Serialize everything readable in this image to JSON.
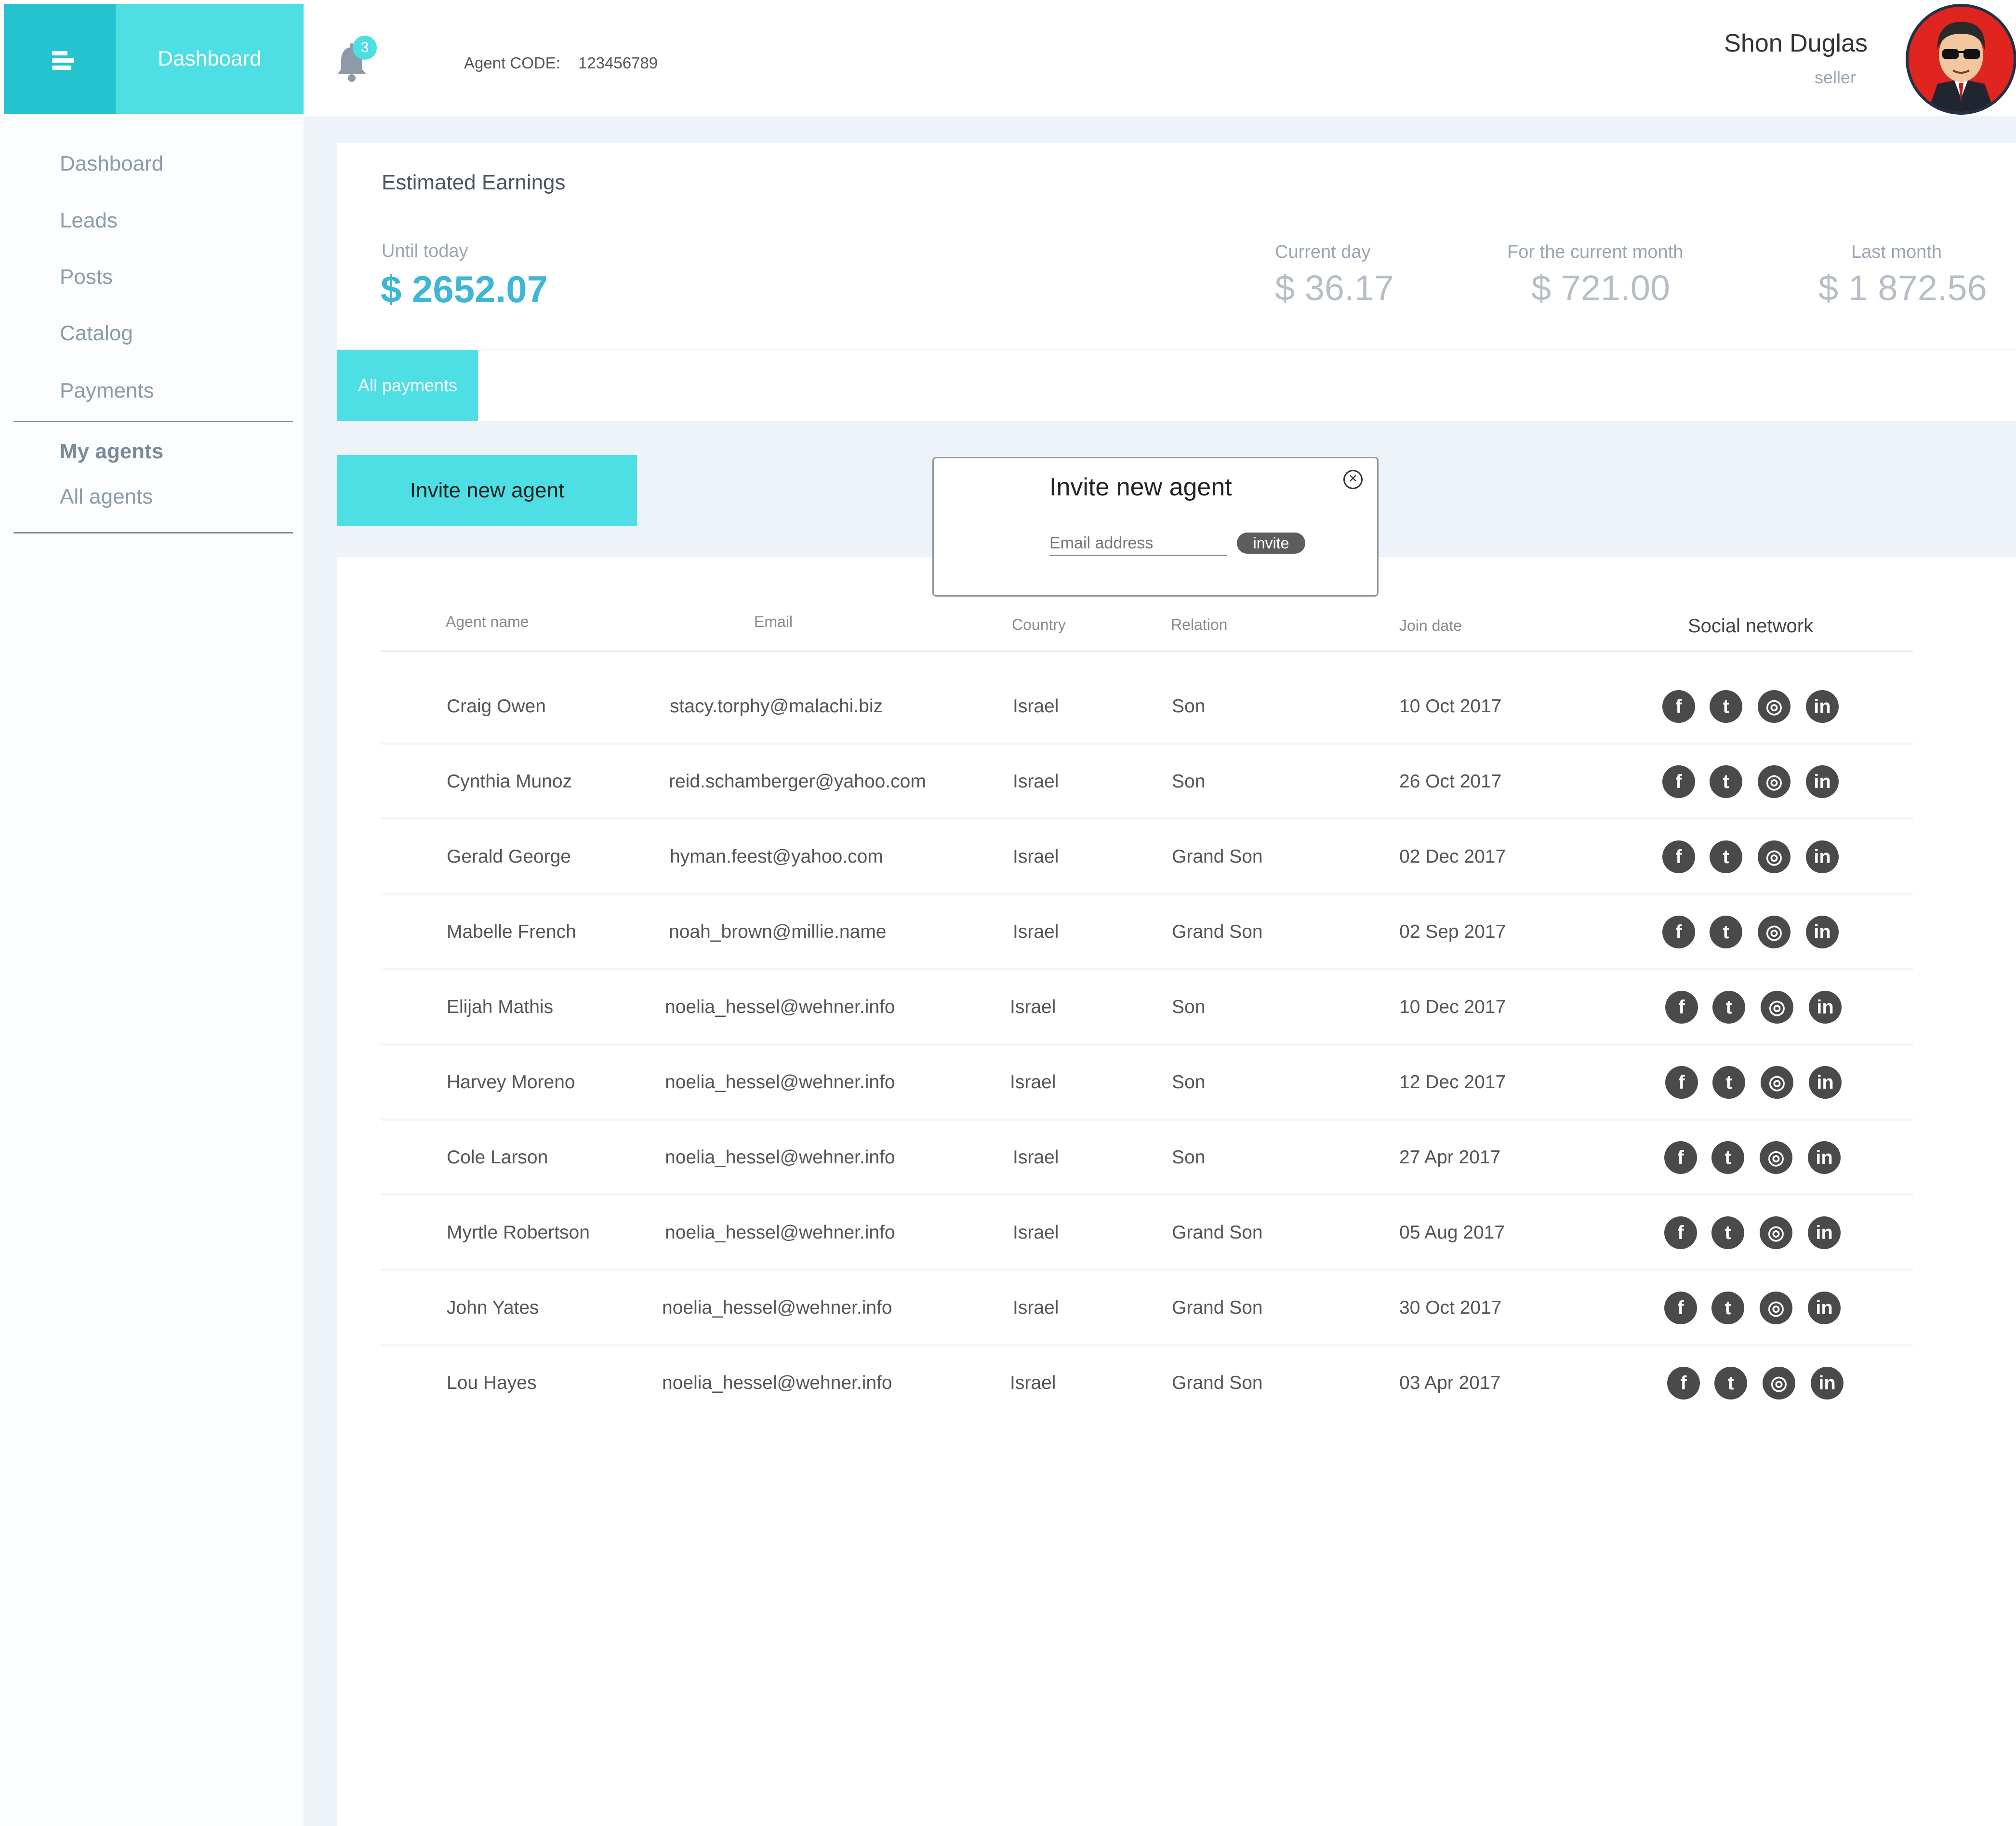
{
  "header": {
    "dashboard_label": "Dashboard",
    "notification_count": "3",
    "agent_code_label": "Agent CODE:",
    "agent_code_value": "123456789",
    "user_name": "Shon Duglas",
    "user_role": "seller"
  },
  "sidebar": {
    "items": [
      {
        "label": "Dashboard"
      },
      {
        "label": "Leads"
      },
      {
        "label": "Posts"
      },
      {
        "label": "Catalog"
      },
      {
        "label": "Payments"
      }
    ],
    "section_title": "My agents",
    "sub_items": [
      {
        "label": "All agents"
      }
    ]
  },
  "earnings": {
    "title": "Estimated Earnings",
    "until_today_label": "Until today",
    "until_today_value": "$ 2652.07",
    "current_day_label": "Current day",
    "current_day_value": "$ 36.17",
    "current_month_label": "For the current month",
    "current_month_value": "$ 721.00",
    "last_month_label": "Last month",
    "last_month_value": "$ 1 872.56"
  },
  "tabs": [
    {
      "label": "All payments"
    }
  ],
  "invite_button_label": "Invite new agent",
  "modal": {
    "title": "Invite new agent",
    "email_placeholder": "Email address",
    "invite_label": "invite"
  },
  "table": {
    "columns": {
      "agent_name": "Agent name",
      "email": "Email",
      "country": "Country",
      "relation": "Relation",
      "join_date": "Join date",
      "social": "Social network"
    },
    "rows": [
      {
        "name": "Craig Owen",
        "email": "stacy.torphy@malachi.biz",
        "country": "Israel",
        "relation": "Son",
        "date": "10 Oct 2017"
      },
      {
        "name": "Cynthia Munoz",
        "email": "reid.schamberger@yahoo.com",
        "country": "Israel",
        "relation": "Son",
        "date": "26 Oct 2017"
      },
      {
        "name": "Gerald George",
        "email": "hyman.feest@yahoo.com",
        "country": "Israel",
        "relation": "Grand Son",
        "date": "02 Dec 2017"
      },
      {
        "name": "Mabelle French",
        "email": "noah_brown@millie.name",
        "country": "Israel",
        "relation": "Grand Son",
        "date": "02 Sep 2017"
      },
      {
        "name": "Elijah Mathis",
        "email": "noelia_hessel@wehner.info",
        "country": "Israel",
        "relation": "Son",
        "date": "10 Dec 2017"
      },
      {
        "name": "Harvey Moreno",
        "email": "noelia_hessel@wehner.info",
        "country": "Israel",
        "relation": "Son",
        "date": "12 Dec 2017"
      },
      {
        "name": "Cole Larson",
        "email": "noelia_hessel@wehner.info",
        "country": "Israel",
        "relation": "Son",
        "date": "27 Apr 2017"
      },
      {
        "name": "Myrtle Robertson",
        "email": "noelia_hessel@wehner.info",
        "country": "Israel",
        "relation": "Grand Son",
        "date": "05 Aug 2017"
      },
      {
        "name": "John Yates",
        "email": "noelia_hessel@wehner.info",
        "country": "Israel",
        "relation": "Grand Son",
        "date": "30 Oct 2017"
      },
      {
        "name": "Lou Hayes",
        "email": "noelia_hessel@wehner.info",
        "country": "Israel",
        "relation": "Grand Son",
        "date": "03 Apr 2017"
      }
    ],
    "social_icons": [
      "facebook-icon",
      "twitter-icon",
      "instagram-icon",
      "linkedin-icon"
    ]
  },
  "colors": {
    "accent": "#4ddfe4",
    "accent_dark": "#25c3cf",
    "earnings_highlight": "#3fb6d6",
    "page_bg": "#eef3f9"
  }
}
